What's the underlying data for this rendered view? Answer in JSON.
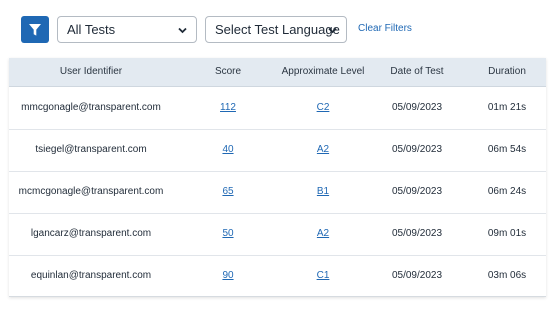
{
  "toolbar": {
    "filter_icon": "filter-funnel-icon",
    "test_select": {
      "value": "All Tests"
    },
    "language_select": {
      "value": "Select Test Language"
    },
    "clear_filters": "Clear Filters",
    "chevron_icon": "chevron-down-icon",
    "accent_color": "#1f68b4"
  },
  "table": {
    "columns": [
      "User Identifier",
      "Score",
      "Approximate Level",
      "Date of Test",
      "Duration"
    ],
    "rows": [
      {
        "user": "mmcgonagle@transparent.com",
        "score": "112",
        "level": "C2",
        "date": "05/09/2023",
        "duration": "01m 21s"
      },
      {
        "user": "tsiegel@transparent.com",
        "score": "40",
        "level": "A2",
        "date": "05/09/2023",
        "duration": "06m 54s"
      },
      {
        "user": "mcmcgonagle@transparent.com",
        "score": "65",
        "level": "B1",
        "date": "05/09/2023",
        "duration": "06m 24s"
      },
      {
        "user": "lgancarz@transparent.com",
        "score": "50",
        "level": "A2",
        "date": "05/09/2023",
        "duration": "09m 01s"
      },
      {
        "user": "equinlan@transparent.com",
        "score": "90",
        "level": "C1",
        "date": "05/09/2023",
        "duration": "03m 06s"
      }
    ]
  }
}
